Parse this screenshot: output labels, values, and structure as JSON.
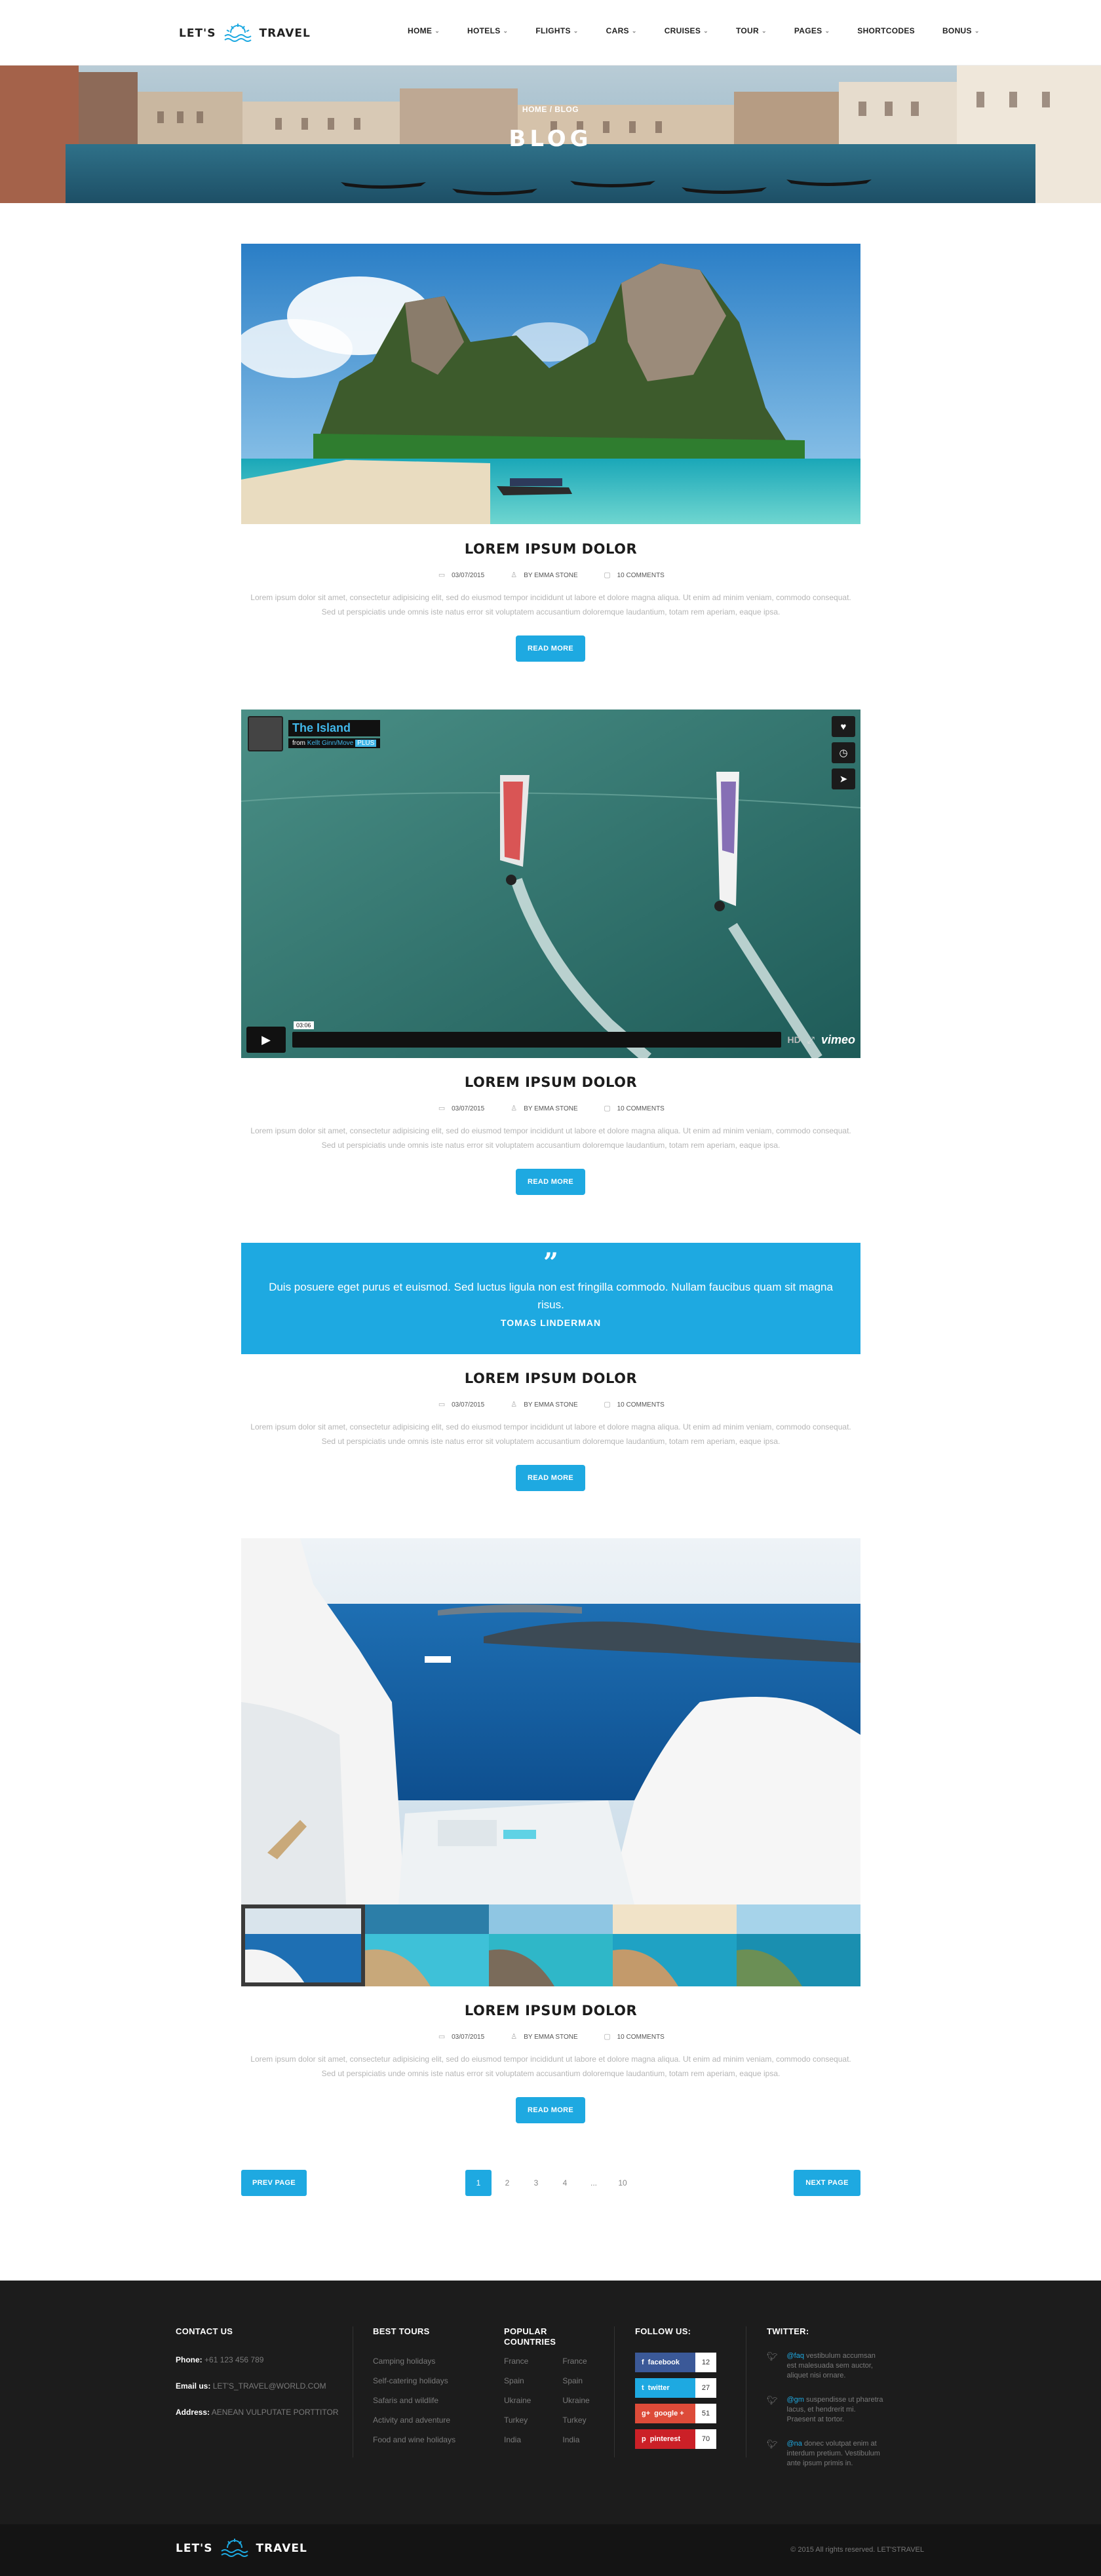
{
  "brand": {
    "left": "LET'S",
    "right": "TRAVEL"
  },
  "nav": [
    "HOME",
    "HOTELS",
    "FLIGHTS",
    "CARS",
    "CRUISES",
    "TOUR",
    "PAGES",
    "SHORTCODES",
    "BONUS"
  ],
  "nav_dropdown": [
    true,
    true,
    true,
    true,
    true,
    true,
    true,
    false,
    true
  ],
  "hero": {
    "breadcrumb": "HOME / BLOG",
    "title": "BLOG"
  },
  "posts": [
    {
      "title": "LOREM IPSUM DOLOR",
      "date": "03/07/2015",
      "author": "BY EMMA STONE",
      "comments": "10 COMMENTS",
      "excerpt": "Lorem ipsum dolor sit amet, consectetur adipisicing elit, sed do eiusmod tempor incididunt ut labore et dolore magna aliqua. Ut enim ad minim veniam, commodo consequat. Sed ut perspiciatis unde omnis iste natus error sit voluptatem accusantium doloremque laudantium, totam rem aperiam, eaque ipsa.",
      "button": "READ MORE"
    },
    {
      "title": "LOREM IPSUM DOLOR",
      "date": "03/07/2015",
      "author": "BY EMMA STONE",
      "comments": "10 COMMENTS",
      "excerpt": "Lorem ipsum dolor sit amet, consectetur adipisicing elit, sed do eiusmod tempor incididunt ut labore et dolore magna aliqua. Ut enim ad minim veniam, commodo consequat. Sed ut perspiciatis unde omnis iste natus error sit voluptatem accusantium doloremque laudantium, totam rem aperiam, eaque ipsa.",
      "button": "READ MORE"
    },
    {
      "title": "LOREM IPSUM DOLOR",
      "date": "03/07/2015",
      "author": "BY EMMA STONE",
      "comments": "10 COMMENTS",
      "excerpt": "Lorem ipsum dolor sit amet, consectetur adipisicing elit, sed do eiusmod tempor incididunt ut labore et dolore magna aliqua. Ut enim ad minim veniam, commodo consequat. Sed ut perspiciatis unde omnis iste natus error sit voluptatem accusantium doloremque laudantium, totam rem aperiam, eaque ipsa.",
      "button": "READ MORE"
    },
    {
      "title": "LOREM IPSUM DOLOR",
      "date": "03/07/2015",
      "author": "BY EMMA STONE",
      "comments": "10 COMMENTS",
      "excerpt": "Lorem ipsum dolor sit amet, consectetur adipisicing elit, sed do eiusmod tempor incididunt ut labore et dolore magna aliqua. Ut enim ad minim veniam, commodo consequat. Sed ut perspiciatis unde omnis iste natus error sit voluptatem accusantium doloremque laudantium, totam rem aperiam, eaque ipsa.",
      "button": "READ MORE"
    }
  ],
  "video": {
    "title": "The Island",
    "from": "from",
    "author": "Kellt Ginn/Move",
    "badge": "PLUS",
    "time": "03:06",
    "hd": "HD",
    "brand": "vimeo"
  },
  "quote": {
    "mark": "”",
    "text": "Duis posuere eget purus et euismod. Sed luctus ligula non est fringilla commodo. Nullam faucibus quam sit magna risus.",
    "author": "TOMAS LINDERMAN"
  },
  "pagination": {
    "prev": "PREV PAGE",
    "next": "NEXT PAGE",
    "pages": [
      "1",
      "2",
      "3",
      "4",
      "...",
      "10"
    ],
    "current": "1"
  },
  "footer": {
    "contact": {
      "heading": "CONTACT US",
      "phone_label": "Phone:",
      "phone": "+61 123 456 789",
      "email_label": "Email us:",
      "email": "LET'S_TRAVEL@WORLD.COM",
      "address_label": "Address:",
      "address": "AENEAN VULPUTATE PORTTITOR"
    },
    "tours": {
      "heading": "BEST TOURS",
      "items": [
        "Camping holidays",
        "Self-catering holidays",
        "Safaris and wildlife",
        "Activity and adventure",
        "Food and wine holidays"
      ]
    },
    "countries": {
      "heading": "POPULAR COUNTRIES",
      "col1": [
        "France",
        "Spain",
        "Ukraine",
        "Turkey",
        "India"
      ],
      "col2": [
        "France",
        "Spain",
        "Ukraine",
        "Turkey",
        "India"
      ]
    },
    "follow": {
      "heading": "FOLLOW US:",
      "items": [
        {
          "name": "facebook",
          "count": "12",
          "color": "#3b5998",
          "icon": "f"
        },
        {
          "name": "twitter",
          "count": "27",
          "color": "#1ea9e1",
          "icon": "t"
        },
        {
          "name": "google +",
          "count": "51",
          "color": "#dd4b39",
          "icon": "g+"
        },
        {
          "name": "pinterest",
          "count": "70",
          "color": "#cb2027",
          "icon": "p"
        }
      ]
    },
    "twitter": {
      "heading": "TWITTER:",
      "tweets": [
        {
          "tag": "@faq",
          "text": "vestibulum accumsan est malesuada sem auctor, aliquet nisi ornare."
        },
        {
          "tag": "@gm",
          "text": "suspendisse ut pharetra lacus, et hendrerit mi. Praesent at tortor."
        },
        {
          "tag": "@na",
          "text": "donec volutpat enim at interdum pretium. Vestibulum ante ipsum primis in."
        }
      ]
    }
  },
  "copyright": "© 2015 All rights reserved. LET'STRAVEL",
  "colors": {
    "accent": "#1ea9e1",
    "footer_bg": "#1c1c1c"
  }
}
